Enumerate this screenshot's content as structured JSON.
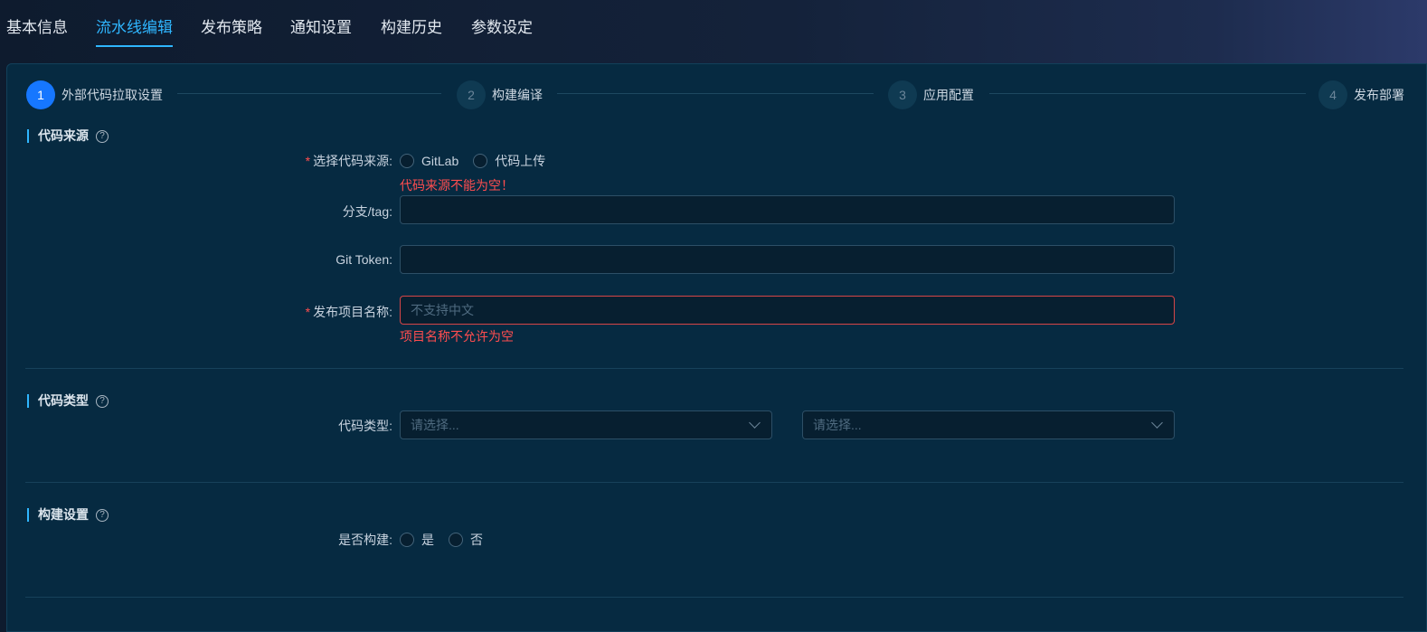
{
  "tabs": [
    {
      "label": "基本信息",
      "active": false
    },
    {
      "label": "流水线编辑",
      "active": true
    },
    {
      "label": "发布策略",
      "active": false
    },
    {
      "label": "通知设置",
      "active": false
    },
    {
      "label": "构建历史",
      "active": false
    },
    {
      "label": "参数设定",
      "active": false
    }
  ],
  "steps": [
    {
      "number": "1",
      "label": "外部代码拉取设置",
      "active": true
    },
    {
      "number": "2",
      "label": "构建编译",
      "active": false
    },
    {
      "number": "3",
      "label": "应用配置",
      "active": false
    },
    {
      "number": "4",
      "label": "发布部署",
      "active": false
    }
  ],
  "sections": {
    "code_source": {
      "title": "代码来源",
      "source_label": "选择代码来源:",
      "source_options": [
        "GitLab",
        "代码上传"
      ],
      "source_error": "代码来源不能为空！",
      "branch_label": "分支/tag:",
      "branch_value": "",
      "token_label": "Git Token:",
      "token_value": "",
      "project_label": "发布项目名称:",
      "project_placeholder": "不支持中文",
      "project_error": "项目名称不允许为空"
    },
    "code_type": {
      "title": "代码类型",
      "type_label": "代码类型:",
      "select_placeholder_1": "请选择...",
      "select_placeholder_2": "请选择..."
    },
    "build": {
      "title": "构建设置",
      "build_label": "是否构建:",
      "options": [
        "是",
        "否"
      ]
    }
  },
  "colors": {
    "accent": "#2fb6ff",
    "step_active": "#1677ff",
    "error": "#ff4d4f",
    "panel": "#062a41"
  }
}
